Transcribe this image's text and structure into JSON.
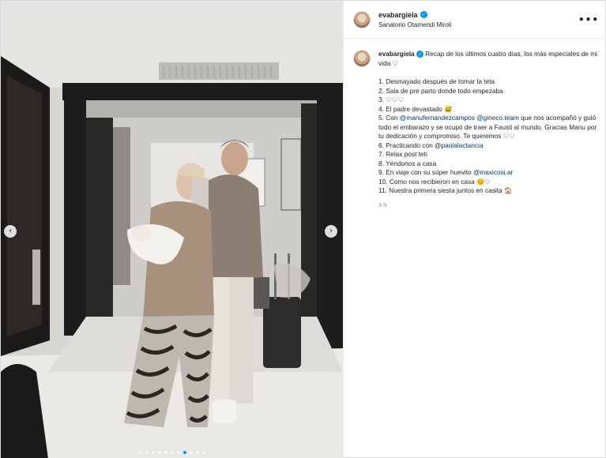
{
  "post": {
    "username": "evabargiela",
    "location": "Sanatorio Otamendi Miroli",
    "more_label": "•••",
    "verified_glyph": "✓",
    "time": "3 h"
  },
  "caption": {
    "intro": "Recap de los últimos cuatro días, los más especiales de mi vida ♡",
    "items": {
      "i1": "1. Desmayado después de tomar la teta",
      "i2": "2. Sala de pre parto donde todo empezaba",
      "i3": "3. ♡♡♡",
      "i4": "4. El padre devastado 😅",
      "i5a": "5. Con",
      "i5_mention1": "@manufernandezcampos",
      "i5_mention2": "@gineco.team",
      "i5b": "que nos acompañó y guió todo el embarazo y se ocupó de traer a Fausti al mundo. Gracias Manu por tu dedicación y compromiso. Te queremos ♡♡",
      "i6a": "6. Practicando con",
      "i6_mention": "@paolalactancia",
      "i7": "7. Relax post teti",
      "i8": "8. Yéndonos a casa",
      "i9a": "9. En viaje con su súper huevito",
      "i9_mention": "@maxicosi.ar",
      "i10": "10. Como nos recibieron en casa 😊♡",
      "i11": "11. Nuestra primera siesta juntos en casita 🏠"
    }
  },
  "carousel": {
    "prev_glyph": "‹",
    "next_glyph": "›",
    "slide_count": 11,
    "active_index": 7
  },
  "icons": {
    "verified": "verified-badge-icon",
    "more": "more-options-icon",
    "prev": "chevron-left-icon",
    "next": "chevron-right-icon"
  },
  "colors": {
    "accent": "#0095f6",
    "mention": "#00376b",
    "muted": "#8e8e8e"
  }
}
